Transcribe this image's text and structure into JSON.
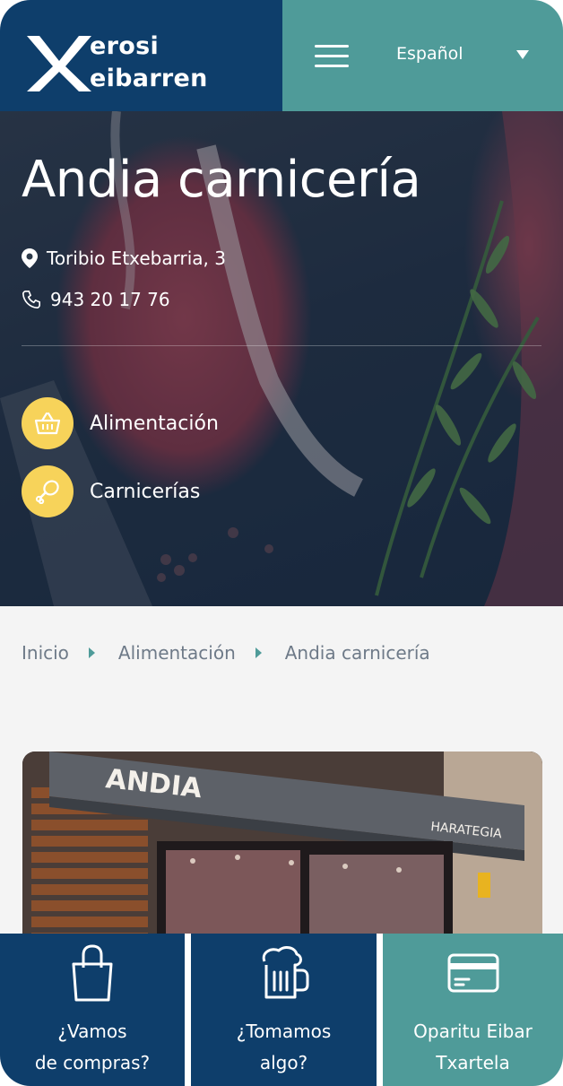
{
  "header": {
    "logo_line1": "erosi",
    "logo_line2": "eibarren",
    "menu_icon": "hamburger-menu-icon",
    "language": "Español"
  },
  "shop": {
    "name": "Andia carnicería",
    "address": "Toribio Etxebarria, 3",
    "phone": "943 20 17 76",
    "categories": [
      {
        "label": "Alimentación",
        "icon": "basket-icon"
      },
      {
        "label": "Carnicerías",
        "icon": "drumstick-icon"
      }
    ],
    "photo_sign": "ANDIA",
    "photo_awning_text": "HARATEGIA"
  },
  "breadcrumb": {
    "items": [
      "Inicio",
      "Alimentación",
      "Andia carnicería"
    ]
  },
  "bottom_nav": [
    {
      "line1": "¿Vamos",
      "line2": "de compras?",
      "icon": "shopping-bag-icon"
    },
    {
      "line1": "¿Tomamos",
      "line2": "algo?",
      "icon": "beer-mug-icon"
    },
    {
      "line1": "Oparitu Eibar",
      "line2": "Txartela",
      "icon": "credit-card-icon"
    }
  ],
  "colors": {
    "navy": "#0e3e6b",
    "teal": "#4f9b99",
    "yellow": "#f7d35a",
    "breadcrumb_text": "#6e7a88",
    "page_bg": "#f4f4f4"
  }
}
